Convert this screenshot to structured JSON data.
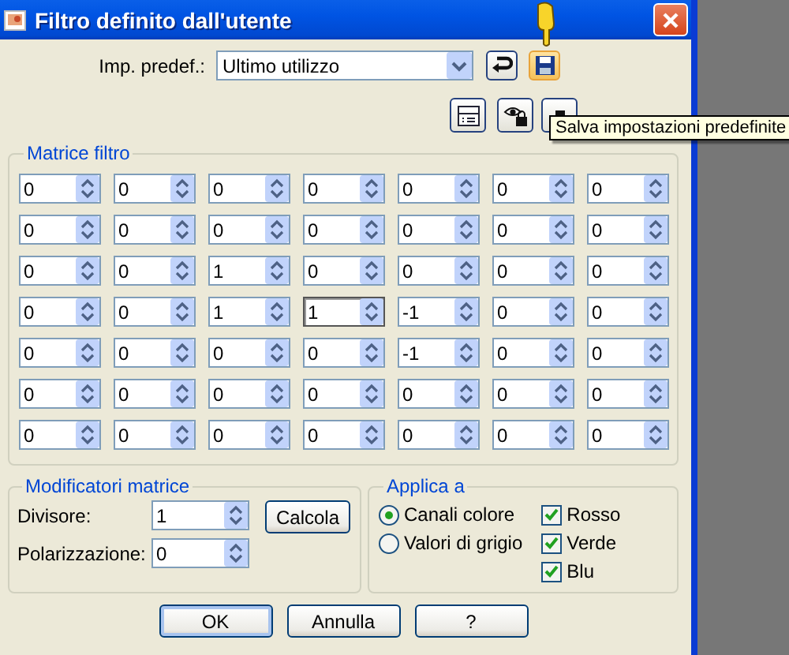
{
  "window": {
    "title": "Filtro definito dall'utente"
  },
  "preset": {
    "label": "Imp. predef.:",
    "value": "Ultimo utilizzo"
  },
  "tooltip": "Salva impostazioni predefinite",
  "matrix": {
    "title": "Matrice filtro",
    "rows": [
      [
        {
          "value": "0",
          "focused": false
        },
        {
          "value": "0",
          "focused": false
        },
        {
          "value": "0",
          "focused": false
        },
        {
          "value": "0",
          "focused": false
        },
        {
          "value": "0",
          "focused": false
        },
        {
          "value": "0",
          "focused": false
        },
        {
          "value": "0",
          "focused": false
        }
      ],
      [
        {
          "value": "0",
          "focused": false
        },
        {
          "value": "0",
          "focused": false
        },
        {
          "value": "0",
          "focused": false
        },
        {
          "value": "0",
          "focused": false
        },
        {
          "value": "0",
          "focused": false
        },
        {
          "value": "0",
          "focused": false
        },
        {
          "value": "0",
          "focused": false
        }
      ],
      [
        {
          "value": "0",
          "focused": false
        },
        {
          "value": "0",
          "focused": false
        },
        {
          "value": "1",
          "focused": false
        },
        {
          "value": "0",
          "focused": false
        },
        {
          "value": "0",
          "focused": false
        },
        {
          "value": "0",
          "focused": false
        },
        {
          "value": "0",
          "focused": false
        }
      ],
      [
        {
          "value": "0",
          "focused": false
        },
        {
          "value": "0",
          "focused": false
        },
        {
          "value": "1",
          "focused": false
        },
        {
          "value": "1",
          "focused": true
        },
        {
          "value": "-1",
          "focused": false
        },
        {
          "value": "0",
          "focused": false
        },
        {
          "value": "0",
          "focused": false
        }
      ],
      [
        {
          "value": "0",
          "focused": false
        },
        {
          "value": "0",
          "focused": false
        },
        {
          "value": "0",
          "focused": false
        },
        {
          "value": "0",
          "focused": false
        },
        {
          "value": "-1",
          "focused": false
        },
        {
          "value": "0",
          "focused": false
        },
        {
          "value": "0",
          "focused": false
        }
      ],
      [
        {
          "value": "0",
          "focused": false
        },
        {
          "value": "0",
          "focused": false
        },
        {
          "value": "0",
          "focused": false
        },
        {
          "value": "0",
          "focused": false
        },
        {
          "value": "0",
          "focused": false
        },
        {
          "value": "0",
          "focused": false
        },
        {
          "value": "0",
          "focused": false
        }
      ],
      [
        {
          "value": "0",
          "focused": false
        },
        {
          "value": "0",
          "focused": false
        },
        {
          "value": "0",
          "focused": false
        },
        {
          "value": "0",
          "focused": false
        },
        {
          "value": "0",
          "focused": false
        },
        {
          "value": "0",
          "focused": false
        },
        {
          "value": "0",
          "focused": false
        }
      ]
    ]
  },
  "modifiers": {
    "title": "Modificatori matrice",
    "fields": [
      {
        "label": "Divisore:",
        "value": "1"
      },
      {
        "label": "Polarizzazione:",
        "value": "0"
      }
    ],
    "button": "Calcola"
  },
  "apply": {
    "title": "Applica a",
    "modes": [
      {
        "label": "Canali colore",
        "selected": true
      },
      {
        "label": "Valori di grigio",
        "selected": false
      }
    ],
    "channels": [
      {
        "label": "Rosso",
        "checked": true
      },
      {
        "label": "Verde",
        "checked": true
      },
      {
        "label": "Blu",
        "checked": true
      }
    ]
  },
  "buttons": [
    {
      "label": "OK",
      "default": true
    },
    {
      "label": "Annulla",
      "default": false
    },
    {
      "label": "?",
      "default": false
    }
  ]
}
